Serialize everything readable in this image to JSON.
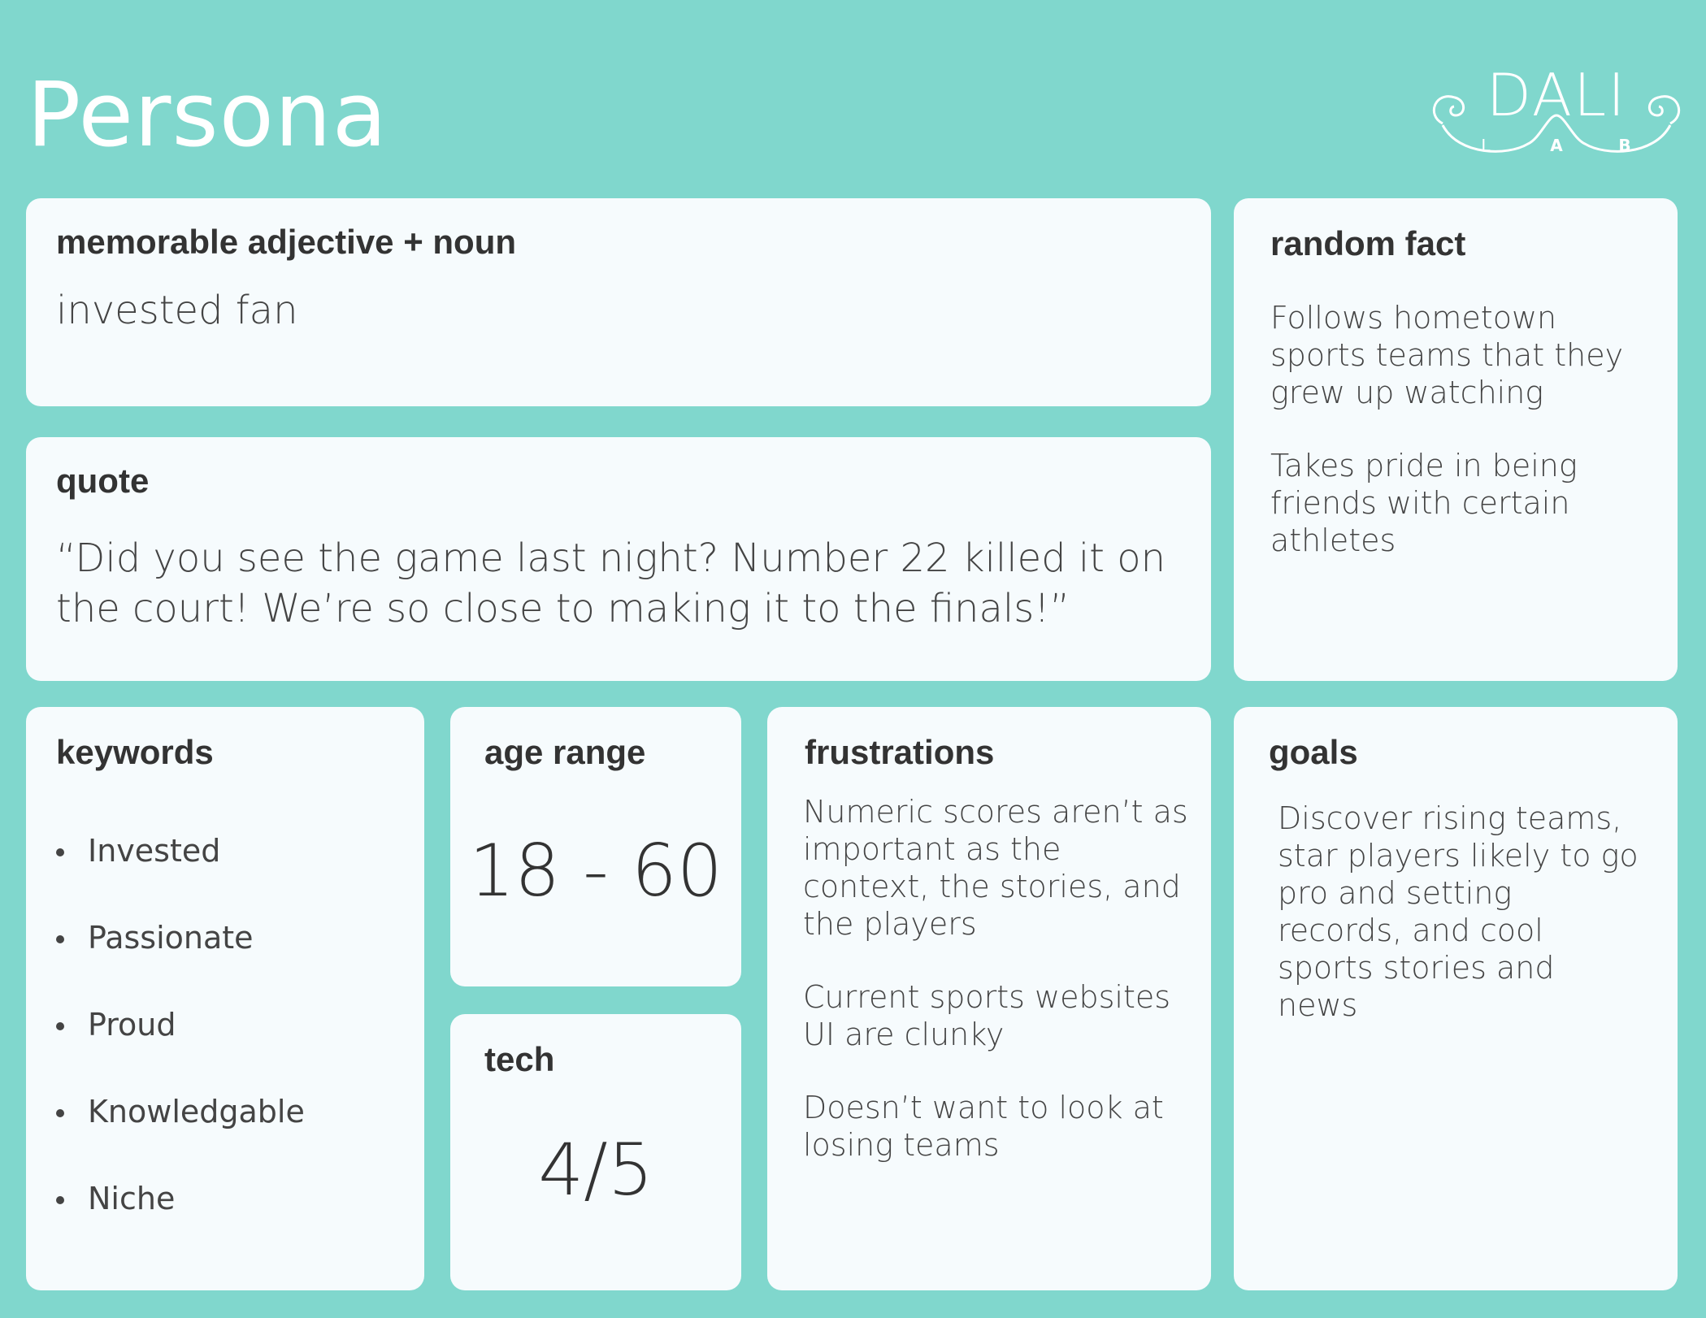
{
  "page": {
    "title": "Persona"
  },
  "logo": {
    "main": "DALI",
    "sub_letters": [
      "L",
      "A",
      "B"
    ]
  },
  "adjective": {
    "label": "memorable adjective + noun",
    "value": "invested fan"
  },
  "quote": {
    "label": "quote",
    "line1": "“Did you see the game last night? Number 22 killed it on",
    "line2": "the court! We’re so close to making it to the finals!”"
  },
  "random_fact": {
    "label": "random fact",
    "paragraphs": [
      "Follows hometown sports teams that they grew up watching",
      "Takes pride in being friends with certain athletes"
    ]
  },
  "keywords": {
    "label": "keywords",
    "items": [
      "Invested",
      "Passionate",
      "Proud",
      "Knowledgable",
      "Niche"
    ]
  },
  "age_range": {
    "label": "age range",
    "value": "18 - 60"
  },
  "tech": {
    "label": "tech",
    "value": "4/5"
  },
  "frustrations": {
    "label": "frustrations",
    "paragraphs": [
      "Numeric scores aren’t as important as the context, the stories, and the players",
      "Current sports websites UI are clunky",
      "Doesn’t want to look at losing teams"
    ]
  },
  "goals": {
    "label": "goals",
    "text": "Discover rising teams, star players likely to go pro and setting records, and cool sports stories and news"
  },
  "colors": {
    "background": "#80d7cd",
    "card": "#f6fbfd",
    "text": "#3b3b3b"
  }
}
